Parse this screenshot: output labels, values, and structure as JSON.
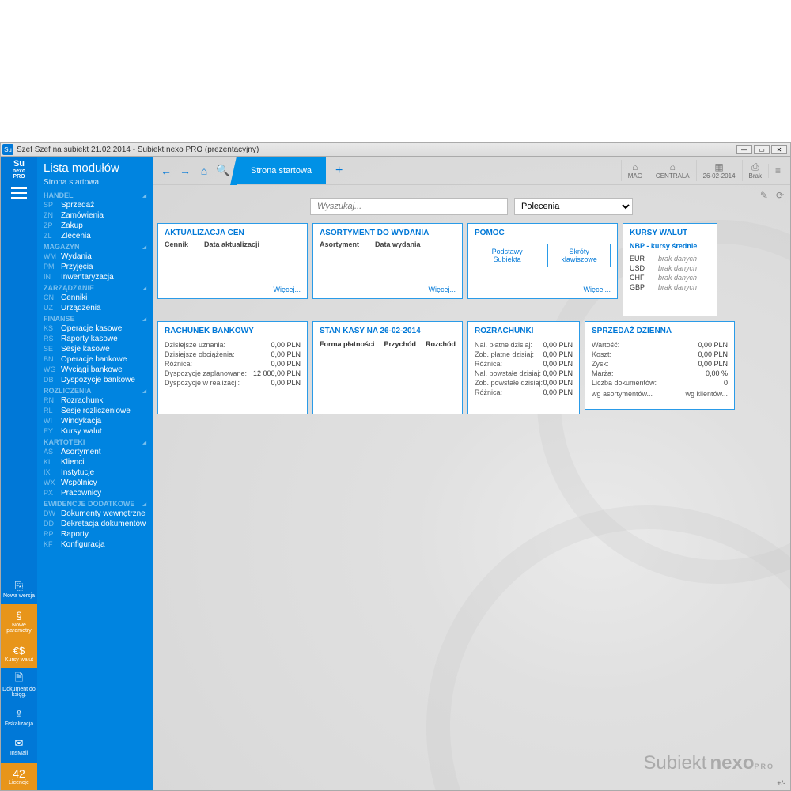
{
  "window": {
    "title": "Szef Szef na subiekt 21.02.2014 - Subiekt nexo PRO (prezentacyjny)"
  },
  "logo": {
    "t1": "Su",
    "t2": "nexo",
    "t3": "PRO"
  },
  "leftbar": [
    {
      "label": "Nowa wersja",
      "icon": "⎘"
    },
    {
      "label": "Nowe parametry",
      "icon": "§",
      "orange": true
    },
    {
      "label": "Kursy walut",
      "icon": "€$",
      "orange": true
    },
    {
      "label": "Dokument do księg.",
      "icon": "🗎"
    },
    {
      "label": "Fiskalizacja",
      "icon": "⇪"
    },
    {
      "label": "InsMail",
      "icon": "✉"
    }
  ],
  "licence": {
    "num": "42",
    "label": "Licencje"
  },
  "sidebar": {
    "title": "Lista modułów",
    "start": "Strona startowa",
    "sections": [
      {
        "header": "HANDEL",
        "items": [
          {
            "code": "SP",
            "label": "Sprzedaż"
          },
          {
            "code": "ZN",
            "label": "Zamówienia"
          },
          {
            "code": "ZP",
            "label": "Zakup"
          },
          {
            "code": "ZL",
            "label": "Zlecenia"
          }
        ]
      },
      {
        "header": "MAGAZYN",
        "items": [
          {
            "code": "WM",
            "label": "Wydania"
          },
          {
            "code": "PM",
            "label": "Przyjęcia"
          },
          {
            "code": "IN",
            "label": "Inwentaryzacja"
          }
        ]
      },
      {
        "header": "ZARZĄDZANIE",
        "items": [
          {
            "code": "CN",
            "label": "Cenniki"
          },
          {
            "code": "UZ",
            "label": "Urządzenia"
          }
        ]
      },
      {
        "header": "FINANSE",
        "items": [
          {
            "code": "KS",
            "label": "Operacje kasowe"
          },
          {
            "code": "RS",
            "label": "Raporty kasowe"
          },
          {
            "code": "SE",
            "label": "Sesje kasowe"
          },
          {
            "code": "BN",
            "label": "Operacje bankowe"
          },
          {
            "code": "WG",
            "label": "Wyciągi bankowe"
          },
          {
            "code": "DB",
            "label": "Dyspozycje bankowe"
          }
        ]
      },
      {
        "header": "ROZLICZENIA",
        "items": [
          {
            "code": "RN",
            "label": "Rozrachunki"
          },
          {
            "code": "RL",
            "label": "Sesje rozliczeniowe"
          },
          {
            "code": "WI",
            "label": "Windykacja"
          },
          {
            "code": "EY",
            "label": "Kursy walut"
          }
        ]
      },
      {
        "header": "KARTOTEKI",
        "items": [
          {
            "code": "AS",
            "label": "Asortyment"
          },
          {
            "code": "KL",
            "label": "Klienci"
          },
          {
            "code": "IX",
            "label": "Instytucje"
          },
          {
            "code": "WX",
            "label": "Wspólnicy"
          },
          {
            "code": "PX",
            "label": "Pracownicy"
          }
        ]
      },
      {
        "header": "EWIDENCJE DODATKOWE",
        "items": [
          {
            "code": "DW",
            "label": "Dokumenty wewnętrzne"
          },
          {
            "code": "DD",
            "label": "Dekretacja dokumentów"
          },
          {
            "code": "RP",
            "label": "Raporty"
          },
          {
            "code": "KF",
            "label": "Konfiguracja"
          }
        ]
      }
    ]
  },
  "tab": "Strona startowa",
  "topright": [
    {
      "icon": "⌂",
      "label": "MAG"
    },
    {
      "icon": "⌂",
      "label": "CENTRALA"
    },
    {
      "icon": "▦",
      "label": "26-02-2014"
    },
    {
      "icon": "⎙",
      "label": "Brak"
    },
    {
      "icon": "≡",
      "label": ""
    }
  ],
  "search": {
    "placeholder": "Wyszukaj...",
    "select": "Polecenia"
  },
  "cards": {
    "aktualizacja": {
      "title": "AKTUALIZACJA CEN",
      "col1": "Cennik",
      "col2": "Data aktualizacji",
      "more": "Więcej..."
    },
    "asortyment": {
      "title": "ASORTYMENT DO WYDANIA",
      "col1": "Asortyment",
      "col2": "Data wydania",
      "more": "Więcej..."
    },
    "pomoc": {
      "title": "POMOC",
      "btn1": "Podstawy Subiekta",
      "btn2": "Skróty klawiszowe",
      "more": "Więcej..."
    },
    "kursy": {
      "title": "KURSY WALUT",
      "sub": "NBP - kursy średnie",
      "rows": [
        {
          "c": "EUR",
          "v": "brak danych"
        },
        {
          "c": "USD",
          "v": "brak danych"
        },
        {
          "c": "CHF",
          "v": "brak danych"
        },
        {
          "c": "GBP",
          "v": "brak danych"
        }
      ]
    },
    "rachunek": {
      "title": "RACHUNEK BANKOWY",
      "rows": [
        {
          "l": "Dzisiejsze uznania:",
          "v": "0,00 PLN"
        },
        {
          "l": "Dzisiejsze obciążenia:",
          "v": "0,00 PLN"
        },
        {
          "l": "Różnica:",
          "v": "0,00 PLN",
          "blue": true
        },
        {
          "l": "Dyspozycje zaplanowane:",
          "v": "12 000,00 PLN"
        },
        {
          "l": "Dyspozycje w realizacji:",
          "v": "0,00 PLN"
        }
      ]
    },
    "stan": {
      "title": "STAN KASY NA 26-02-2014",
      "h1": "Forma płatności",
      "h2": "Przychód",
      "h3": "Rozchód"
    },
    "rozrachunki": {
      "title": "ROZRACHUNKI",
      "rows": [
        {
          "l": "Nal. płatne dzisiaj:",
          "v": "0,00 PLN"
        },
        {
          "l": "Zob. płatne dzisiaj:",
          "v": "0,00 PLN"
        },
        {
          "l": "Różnica:",
          "v": "0,00 PLN",
          "blue": true
        },
        {
          "l": "Nal. powstałe dzisiaj:",
          "v": "0,00 PLN"
        },
        {
          "l": "Zob. powstałe dzisiaj:",
          "v": "0,00 PLN"
        },
        {
          "l": "Różnica:",
          "v": "0,00 PLN",
          "blue": true
        }
      ]
    },
    "sprzedaz": {
      "title": "SPRZEDAŻ DZIENNA",
      "rows": [
        {
          "l": "Wartość:",
          "v": "0,00 PLN"
        },
        {
          "l": "Koszt:",
          "v": "0,00 PLN"
        },
        {
          "l": "Zysk:",
          "v": "0,00 PLN"
        },
        {
          "l": "Marża:",
          "v": "0,00 %"
        },
        {
          "l": "Liczba dokumentów:",
          "v": "0"
        }
      ],
      "f1": "wg asortymentów...",
      "f2": "wg klientów..."
    }
  },
  "brand": {
    "t1": "Subiekt",
    "t2": "nexo",
    "t3": "PRO"
  },
  "pm": "+/-"
}
